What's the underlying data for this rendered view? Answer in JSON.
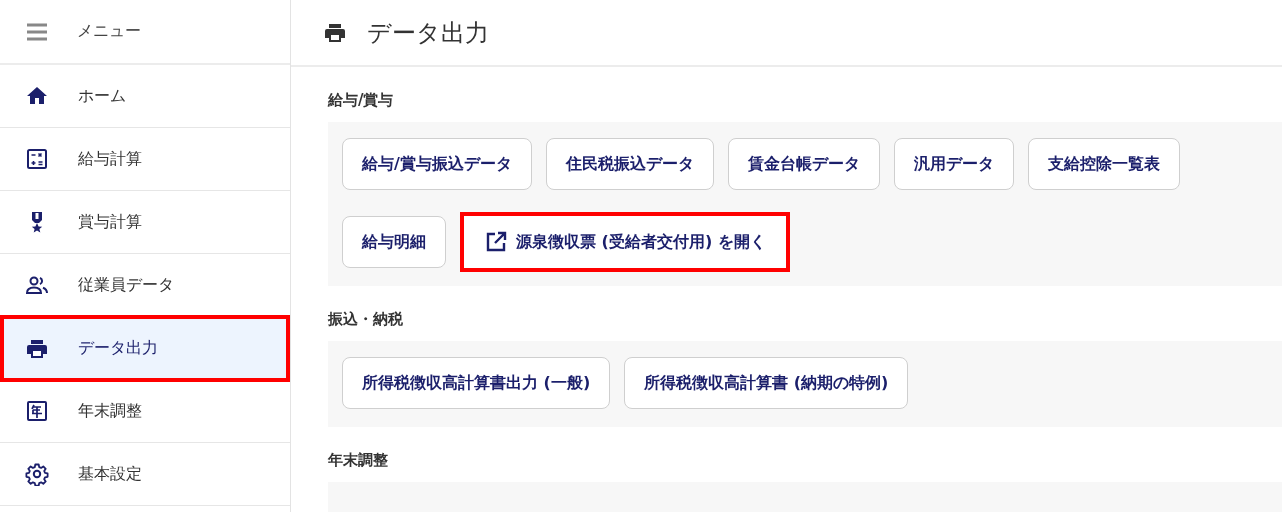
{
  "sidebar": {
    "menu_label": "メニュー",
    "items": [
      {
        "label": "ホーム",
        "kind": "home",
        "selected": false,
        "highlighted": false
      },
      {
        "label": "給与計算",
        "kind": "calculator",
        "selected": false,
        "highlighted": false
      },
      {
        "label": "賞与計算",
        "kind": "medal",
        "selected": false,
        "highlighted": false
      },
      {
        "label": "従業員データ",
        "kind": "people",
        "selected": false,
        "highlighted": false
      },
      {
        "label": "データ出力",
        "kind": "printer",
        "selected": true,
        "highlighted": true
      },
      {
        "label": "年末調整",
        "kind": "calendar",
        "selected": false,
        "highlighted": false
      },
      {
        "label": "基本設定",
        "kind": "gear",
        "selected": false,
        "highlighted": false
      }
    ]
  },
  "page": {
    "title": "データ出力",
    "sections": [
      {
        "title": "給与/賞与",
        "buttons": [
          {
            "label": "給与/賞与振込データ",
            "external": false,
            "highlighted": false
          },
          {
            "label": "住民税振込データ",
            "external": false,
            "highlighted": false
          },
          {
            "label": "賃金台帳データ",
            "external": false,
            "highlighted": false
          },
          {
            "label": "汎用データ",
            "external": false,
            "highlighted": false
          },
          {
            "label": "支給控除一覧表",
            "external": false,
            "highlighted": false
          },
          {
            "label": "給与明細",
            "external": false,
            "highlighted": false
          },
          {
            "label": "源泉徴収票 (受給者交付用) を開く",
            "external": true,
            "highlighted": true
          }
        ]
      },
      {
        "title": "振込・納税",
        "buttons": [
          {
            "label": "所得税徴収高計算書出力 (一般)",
            "external": false,
            "highlighted": false
          },
          {
            "label": "所得税徴収高計算書 (納期の特例)",
            "external": false,
            "highlighted": false
          }
        ]
      },
      {
        "title": "年末調整"
      }
    ]
  }
}
